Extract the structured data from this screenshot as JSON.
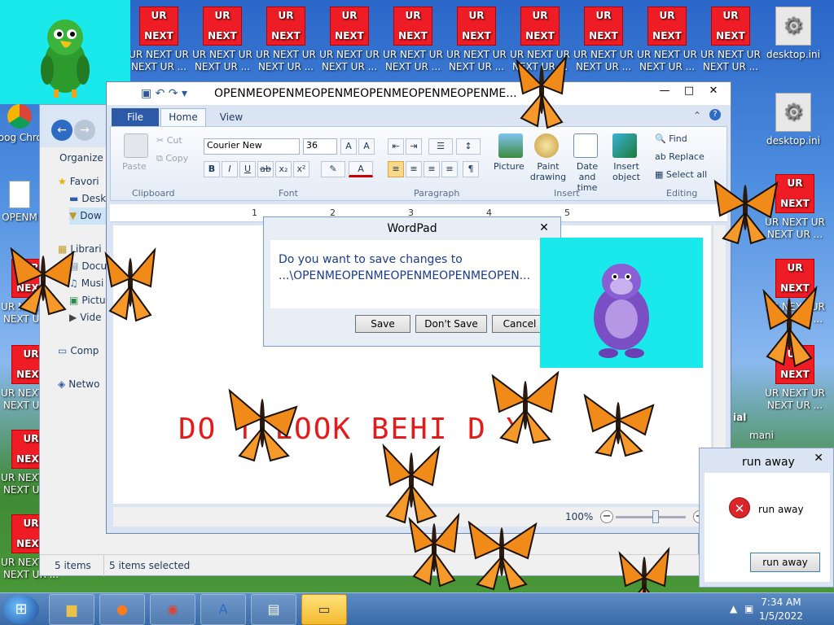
{
  "desktop": {
    "red_icon": {
      "top": "UR",
      "bottom": "NEXT",
      "caption_line1": "UR NEXT UR",
      "caption_line2": "NEXT UR ..."
    },
    "left_icons": [
      "Goog Chron",
      "OPENM"
    ],
    "right_icons": [
      "desktop.ini",
      "desktop.ini"
    ],
    "right_partial_labels": [
      "ial",
      "mani"
    ]
  },
  "explorer": {
    "organize_label": "Organize",
    "sidebar": [
      {
        "label": "Favori",
        "icon": "star-icon"
      },
      {
        "label": "Desk",
        "icon": "desktop-icon"
      },
      {
        "label": "Dow",
        "icon": "downloads-icon"
      },
      {
        "label": "Librari",
        "icon": "libraries-icon"
      },
      {
        "label": "Docu",
        "icon": "documents-icon"
      },
      {
        "label": "Musi",
        "icon": "music-icon"
      },
      {
        "label": "Pictu",
        "icon": "pictures-icon"
      },
      {
        "label": "Vide",
        "icon": "videos-icon"
      },
      {
        "label": "Comp",
        "icon": "computer-icon"
      },
      {
        "label": "Netwo",
        "icon": "network-icon"
      }
    ],
    "status_items": "5 items",
    "status_selected": "5 items selected"
  },
  "wordpad": {
    "title": "OPENMEOPENMEOPENMEOPENMEOPENMEOPENME...",
    "tabs": {
      "file": "File",
      "home": "Home",
      "view": "View"
    },
    "clipboard": {
      "paste": "Paste",
      "cut": "Cut",
      "copy": "Copy",
      "group": "Clipboard"
    },
    "font": {
      "family": "Courier New",
      "size": "36",
      "group": "Font"
    },
    "paragraph": {
      "group": "Paragraph"
    },
    "insert": {
      "picture": "Picture",
      "paint": "Paint drawing",
      "datetime": "Date and time",
      "object": "Insert object",
      "group": "Insert"
    },
    "editing": {
      "find": "Find",
      "replace": "Replace",
      "select_all": "Select all",
      "group": "Editing"
    },
    "ruler_numbers": [
      "1",
      "2",
      "3",
      "4",
      "5"
    ],
    "document_text": "DO  T LOOK BEHI D Y",
    "zoom": "100%",
    "zoom_percent": 100
  },
  "dialog": {
    "title": "WordPad",
    "message_line1": "Do you want to save changes to",
    "message_line2": "...\\OPENMEOPENMEOPENMEOPENMEOPEN...",
    "save": "Save",
    "dont_save": "Don't Save",
    "cancel": "Cancel"
  },
  "runaway": {
    "title": "run away",
    "message": "run away",
    "button": "run away"
  },
  "taskbar": {
    "time": "7:34 AM",
    "date": "1/5/2022"
  },
  "colors": {
    "cyan_box": "#19e9ea",
    "red_icon": "#ee1c24",
    "doc_text": "#e41b1b",
    "butterfly": "#f08a18"
  }
}
